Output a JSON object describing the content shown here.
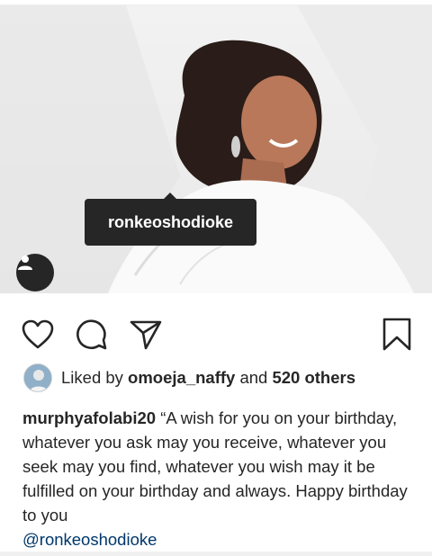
{
  "post": {
    "tagged_username": "ronkeoshodioke"
  },
  "actions": {
    "like_icon": "heart-icon",
    "comment_icon": "comment-icon",
    "share_icon": "paper-plane-icon",
    "save_icon": "bookmark-icon"
  },
  "likes": {
    "prefix": "Liked by",
    "user": "omoeja_naffy",
    "and": "and",
    "others": "520 others"
  },
  "caption": {
    "username": "murphyafolabi20",
    "text": "“A wish for you on your birthday, whatever you ask may you receive, whatever you seek may you find, whatever you wish may it be fulfilled on your birthday and always. Happy birthday to you",
    "mention": "@ronkeoshodioke"
  },
  "colors": {
    "text": "#262626",
    "mention": "#00376b",
    "tag_bubble": "#262626"
  }
}
